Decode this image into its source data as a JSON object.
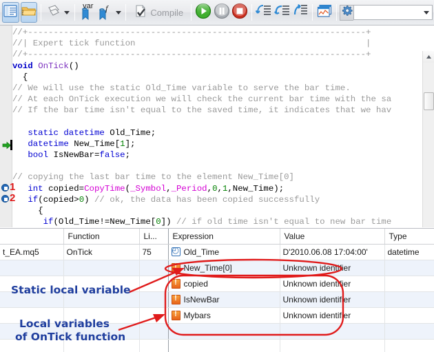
{
  "toolbar": {
    "buttons": [
      {
        "name": "toggle-navigator-button",
        "icon": "panel-layout-icon",
        "pressed": true
      },
      {
        "name": "open-folder-button",
        "icon": "folder-dotted-icon",
        "pressed": true
      },
      {
        "name": "properties-button",
        "icon": "pages-icon",
        "pressed": false
      },
      {
        "name": "insert-variable-button",
        "icon": "var-bookmark-icon",
        "label": "var",
        "pressed": false
      },
      {
        "name": "insert-function-button",
        "icon": "function-bookmark-icon",
        "label": "f",
        "pressed": false
      },
      {
        "name": "compile-button",
        "icon": "compile-page-icon",
        "label": "Compile",
        "pressed": false
      },
      {
        "name": "start-button",
        "icon": "play-icon",
        "pressed": false
      },
      {
        "name": "pause-button",
        "icon": "pause-icon",
        "pressed": false
      },
      {
        "name": "stop-button",
        "icon": "stop-icon",
        "pressed": false
      },
      {
        "name": "step-into-button",
        "icon": "step-into-icon",
        "pressed": false
      },
      {
        "name": "step-over-button",
        "icon": "step-over-icon",
        "pressed": false
      },
      {
        "name": "step-out-button",
        "icon": "step-out-icon",
        "pressed": false
      },
      {
        "name": "open-chart-button",
        "icon": "chart-window-icon",
        "pressed": false
      },
      {
        "name": "settings-button",
        "icon": "gear-icon",
        "pressed": false
      }
    ],
    "compile_label": "Compile",
    "var_label": "var",
    "func_label": "f",
    "symbol_combo_value": ""
  },
  "editor": {
    "lines": [
      {
        "id": 1,
        "marker": null,
        "segments": [
          {
            "t": "//+------------------------------------------------------------------+",
            "c": "cmt"
          }
        ]
      },
      {
        "id": 2,
        "marker": null,
        "segments": [
          {
            "t": "//| Expert tick function                                             |",
            "c": "cmt"
          }
        ]
      },
      {
        "id": 3,
        "marker": null,
        "segments": [
          {
            "t": "//+------------------------------------------------------------------+",
            "c": "cmt"
          }
        ]
      },
      {
        "id": 4,
        "marker": null,
        "segments": [
          {
            "t": "void ",
            "c": "kw"
          },
          {
            "t": "OnTick",
            "c": "fn"
          },
          {
            "t": "()",
            "c": "pl"
          }
        ]
      },
      {
        "id": 5,
        "marker": null,
        "segments": [
          {
            "t": "  {",
            "c": "pl"
          }
        ]
      },
      {
        "id": 6,
        "marker": null,
        "segments": [
          {
            "t": "// We will use the static Old_Time variable to serve the bar time.",
            "c": "cmt"
          }
        ]
      },
      {
        "id": 7,
        "marker": null,
        "segments": [
          {
            "t": "// At each OnTick execution we will check the current bar time with the sa",
            "c": "cmt"
          }
        ]
      },
      {
        "id": 8,
        "marker": null,
        "segments": [
          {
            "t": "// If the bar time isn't equal to the saved time, it indicates that we hav",
            "c": "cmt"
          }
        ]
      },
      {
        "id": 9,
        "marker": null,
        "segments": [
          {
            "t": "",
            "c": "pl"
          }
        ]
      },
      {
        "id": 10,
        "marker": null,
        "segments": [
          {
            "t": "   ",
            "c": "pl"
          },
          {
            "t": "static datetime ",
            "c": "typ"
          },
          {
            "t": "Old_Time;",
            "c": "pl"
          }
        ]
      },
      {
        "id": 11,
        "marker": "exec",
        "segments": [
          {
            "t": "   ",
            "c": "pl"
          },
          {
            "t": "datetime ",
            "c": "typ"
          },
          {
            "t": "New_Time[",
            "c": "pl"
          },
          {
            "t": "1",
            "c": "num"
          },
          {
            "t": "];",
            "c": "pl"
          }
        ]
      },
      {
        "id": 12,
        "marker": null,
        "segments": [
          {
            "t": "   ",
            "c": "pl"
          },
          {
            "t": "bool ",
            "c": "typ"
          },
          {
            "t": "IsNewBar=",
            "c": "pl"
          },
          {
            "t": "false",
            "c": "typ"
          },
          {
            "t": ";",
            "c": "pl"
          }
        ]
      },
      {
        "id": 13,
        "marker": null,
        "segments": [
          {
            "t": "",
            "c": "pl"
          }
        ]
      },
      {
        "id": 14,
        "marker": null,
        "segments": [
          {
            "t": "// copying the last bar time to the element New_Time[0]",
            "c": "cmt"
          }
        ]
      },
      {
        "id": 15,
        "marker": "bp1",
        "segments": [
          {
            "t": "   ",
            "c": "pl"
          },
          {
            "t": "int ",
            "c": "typ"
          },
          {
            "t": "copied=",
            "c": "pl"
          },
          {
            "t": "CopyTime",
            "c": "fnc"
          },
          {
            "t": "(",
            "c": "pl"
          },
          {
            "t": "_Symbol",
            "c": "mac"
          },
          {
            "t": ",",
            "c": "pl"
          },
          {
            "t": "_Period",
            "c": "mac"
          },
          {
            "t": ",",
            "c": "pl"
          },
          {
            "t": "0",
            "c": "num"
          },
          {
            "t": ",",
            "c": "pl"
          },
          {
            "t": "1",
            "c": "num"
          },
          {
            "t": ",New_Time);",
            "c": "pl"
          }
        ]
      },
      {
        "id": 16,
        "marker": "bp2",
        "segments": [
          {
            "t": "   ",
            "c": "pl"
          },
          {
            "t": "if",
            "c": "typ"
          },
          {
            "t": "(copied>",
            "c": "pl"
          },
          {
            "t": "0",
            "c": "num"
          },
          {
            "t": ") ",
            "c": "pl"
          },
          {
            "t": "// ok, the data has been copied successfully",
            "c": "cmt"
          }
        ]
      },
      {
        "id": 17,
        "marker": null,
        "segments": [
          {
            "t": "     {",
            "c": "pl"
          }
        ]
      },
      {
        "id": 18,
        "marker": null,
        "segments": [
          {
            "t": "      ",
            "c": "pl"
          },
          {
            "t": "if",
            "c": "typ"
          },
          {
            "t": "(Old_Time!=New_Time[",
            "c": "pl"
          },
          {
            "t": "0",
            "c": "num"
          },
          {
            "t": "]) ",
            "c": "pl"
          },
          {
            "t": "// if old time isn't equal to new bar time",
            "c": "cmt"
          }
        ]
      },
      {
        "id": 19,
        "marker": null,
        "segments": [
          {
            "t": "        {",
            "c": "pl"
          }
        ]
      }
    ],
    "breakpoint_numbers": {
      "bp1": "1",
      "bp2": "2"
    },
    "hscroll_grip": "‖"
  },
  "debug_table": {
    "headers": [
      "",
      "Function",
      "Li...",
      "Expression",
      "Value",
      "Type"
    ],
    "rows": [
      {
        "file": "t_EA.mq5",
        "function": "OnTick",
        "line": "75",
        "icon": "clock-icon",
        "expression": "Old_Time",
        "value": "D'2010.06.08 17:04:00'",
        "type": "datetime"
      },
      {
        "file": "",
        "function": "",
        "line": "",
        "icon": "warning-icon",
        "expression": "New_Time[0]",
        "value": "Unknown identifier",
        "type": ""
      },
      {
        "file": "",
        "function": "",
        "line": "",
        "icon": "warning-icon",
        "expression": "copied",
        "value": "Unknown identifier",
        "type": ""
      },
      {
        "file": "",
        "function": "",
        "line": "",
        "icon": "warning-icon",
        "expression": "IsNewBar",
        "value": "Unknown identifier",
        "type": ""
      },
      {
        "file": "",
        "function": "",
        "line": "",
        "icon": "warning-icon",
        "expression": "Mybars",
        "value": "Unknown identifier",
        "type": ""
      },
      {
        "file": "",
        "function": "",
        "line": "",
        "icon": "",
        "expression": "",
        "value": "",
        "type": ""
      },
      {
        "file": "",
        "function": "",
        "line": "",
        "icon": "",
        "expression": "",
        "value": "",
        "type": ""
      }
    ]
  },
  "annotations": {
    "static_local": "Static local variable",
    "local_vars_line1": "Local variables",
    "local_vars_line2": "of OnTick function",
    "color": "#1f3e9e",
    "highlight_color": "#e01b1b"
  }
}
